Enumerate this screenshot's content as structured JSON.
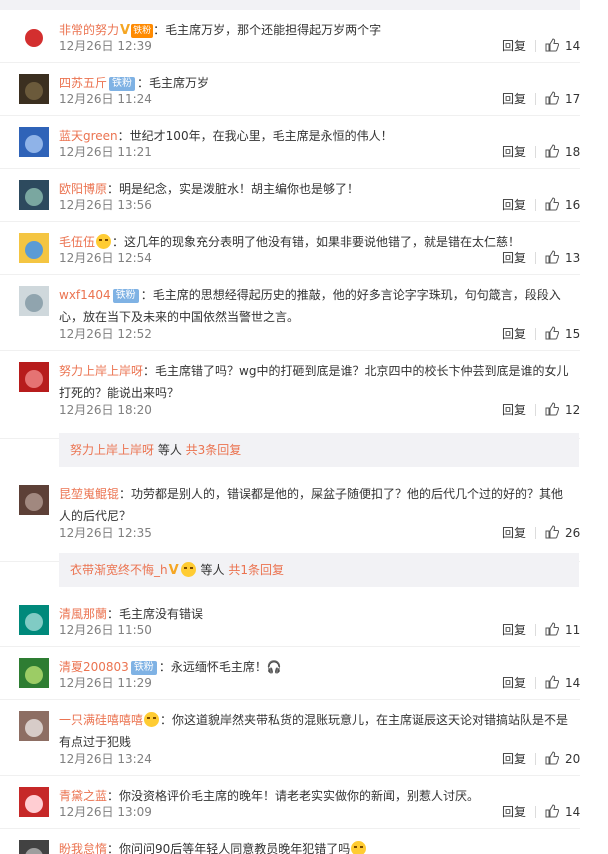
{
  "reply_label": "回复",
  "comments": [
    {
      "user": "非常的努力",
      "badge": "",
      "vip": true,
      "fan": "铁粉",
      "text": "：毛主席万岁，那个还能担得起万岁两个字",
      "time": "12月26日 12:39",
      "likes": "14",
      "avatar_colors": [
        "#ffffff",
        "#d32f2f"
      ]
    },
    {
      "user": "四苏五斤",
      "badge": "铁粉",
      "vip": false,
      "fan": "",
      "text": "：毛主席万岁",
      "time": "12月26日 11:24",
      "likes": "17",
      "avatar_colors": [
        "#3b2f20",
        "#6b5a3b"
      ]
    },
    {
      "user": "蓝天green",
      "badge": "",
      "vip": false,
      "fan": "",
      "text": "：世纪才100年，在我心里，毛主席是永恒的伟人！",
      "time": "12月26日 11:21",
      "likes": "18",
      "avatar_colors": [
        "#2f63b8",
        "#8fb3e8"
      ]
    },
    {
      "user": "欧阳博原",
      "badge": "",
      "vip": false,
      "fan": "",
      "text": "：明是纪念，实是泼脏水！胡主编你也是够了！",
      "time": "12月26日 13:56",
      "likes": "16",
      "avatar_colors": [
        "#2d4a5e",
        "#7aa7a0"
      ]
    },
    {
      "user": "毛伍伍",
      "badge": "",
      "vip": false,
      "fan": "",
      "emoji": true,
      "text": "：这几年的现象充分表明了他没有错，如果非要说他错了，就是错在太仁慈！",
      "time": "12月26日 12:54",
      "likes": "13",
      "avatar_colors": [
        "#f4c542",
        "#5a9bd5"
      ]
    },
    {
      "user": "wxf1404",
      "badge": "铁粉",
      "vip": false,
      "fan": "",
      "text": "：毛主席的思想经得起历史的推敲，他的好多言论字字珠玑，句句箴言，段段入心，放在当下及未来的中国依然当警世之言。",
      "time": "12月26日 12:52",
      "likes": "15",
      "avatar_colors": [
        "#cfd8dc",
        "#90a4ae"
      ]
    },
    {
      "user": "努力上岸上岸呀",
      "badge": "",
      "vip": false,
      "fan": "",
      "text": "：毛主席错了吗？wg中的打砸到底是谁？北京四中的校长卞仲芸到底是谁的女儿打死的？能说出来吗？",
      "time": "12月26日 18:20",
      "likes": "12",
      "avatar_colors": [
        "#b71c1c",
        "#e57373"
      ]
    },
    {
      "user": "昆堃嵬鲲锟",
      "badge": "",
      "vip": false,
      "fan": "",
      "text": "：功劳都是别人的，错误都是他的，屎盆子随便扣了？他的后代几个过的好的？其他人的后代尼？",
      "time": "12月26日 12:35",
      "likes": "26",
      "avatar_colors": [
        "#5d4037",
        "#a1887f"
      ]
    },
    {
      "user": "清風那蘭",
      "badge": "",
      "vip": false,
      "fan": "",
      "text": "：毛主席没有错误",
      "time": "12月26日 11:50",
      "likes": "11",
      "avatar_colors": [
        "#00897b",
        "#80cbc4"
      ]
    },
    {
      "user": "清夏200803",
      "badge": "铁粉",
      "vip": false,
      "fan": "",
      "text": "：永远缅怀毛主席！🎧",
      "time": "12月26日 11:29",
      "likes": "14",
      "avatar_colors": [
        "#2e7d32",
        "#9ccc65"
      ]
    },
    {
      "user": "一只满硅嘻嘻嘻",
      "badge": "",
      "vip": false,
      "fan": "",
      "emoji": true,
      "text": "：你这道貌岸然夹带私货的混账玩意儿，在主席诞辰这天论对错搞站队是不是有点过于犯贱",
      "time": "12月26日 13:24",
      "likes": "20",
      "avatar_colors": [
        "#8d6e63",
        "#d7ccc8"
      ]
    },
    {
      "user": "青黛之蓝",
      "badge": "",
      "vip": false,
      "fan": "",
      "text": "：你没资格评价毛主席的晚年！请老老实实做你的新闻，别惹人讨厌。",
      "time": "12月26日 13:09",
      "likes": "14",
      "avatar_colors": [
        "#c62828",
        "#ffcdd2"
      ]
    },
    {
      "user": "盼我怠惰",
      "badge": "",
      "vip": false,
      "fan": "",
      "text": "：你问问90后等年轻人同意教员晚年犯错了吗",
      "emoji_tail": true,
      "time": "",
      "likes": "",
      "avatar_colors": [
        "#424242",
        "#9e9e9e"
      ]
    }
  ],
  "more_replies": [
    {
      "user": "努力上岸上岸呀",
      "middle": " 等人 ",
      "link": "共3条回复"
    },
    {
      "user": "衣带渐宽终不悔_h",
      "middle": " 等人 ",
      "link": "共1条回复"
    }
  ]
}
